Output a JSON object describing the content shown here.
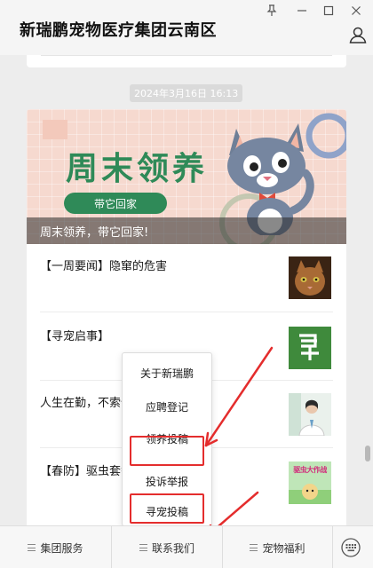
{
  "window": {
    "title": "新瑞鹏宠物医疗集团云南区"
  },
  "chat": {
    "timestamp": "2024年3月16日 16:13",
    "article": {
      "banner_heading": "周末领养",
      "banner_pill": "带它回家",
      "banner_caption": "周末领养，带它回家!",
      "items": [
        {
          "title": "【一周要闻】隐窜的危害"
        },
        {
          "title": "【寻宠启事】"
        },
        {
          "title": "人生在勤，不索何获"
        },
        {
          "title": "【春防】驱虫套餐"
        }
      ],
      "thumb_labels": {
        "poster_title": "驱虫大作战"
      }
    }
  },
  "popup_menu": {
    "items": [
      {
        "label": "关于新瑞鹏"
      },
      {
        "label": "应聘登记"
      },
      {
        "label": "领养投稿"
      },
      {
        "label": "投诉举报"
      },
      {
        "label": "寻宠投稿"
      }
    ]
  },
  "bottom_menu": {
    "items": [
      {
        "label": "集团服务"
      },
      {
        "label": "联系我们"
      },
      {
        "label": "宠物福利"
      }
    ]
  },
  "colors": {
    "highlight": "#e42d2d",
    "banner_green": "#2f8a58",
    "banner_bg": "#f6d9cf"
  }
}
